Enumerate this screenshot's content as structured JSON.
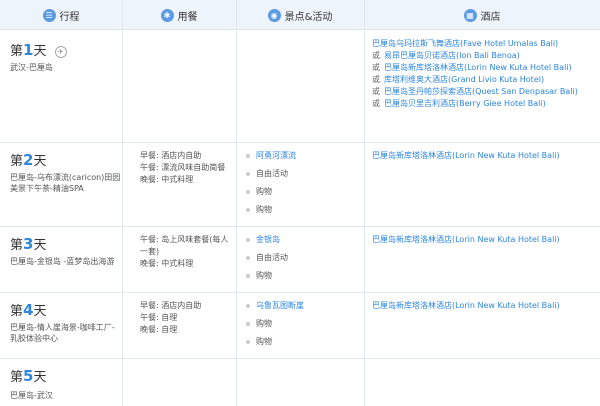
{
  "header": {
    "itinerary": "行程",
    "meals": "用餐",
    "activities": "景点&活动",
    "hotel": "酒店"
  },
  "days": [
    {
      "day_prefix": "第",
      "day_num": "1",
      "day_suffix": "天",
      "route": "武汉-巴厘岛",
      "meals": [],
      "activities": [],
      "hotels": [
        "巴厘岛乌玛拉斯飞舞酒店(Fave Hotel Umalas Bali)",
        "易昂巴厘岛贝诺酒店(Ion Bali Benoa)",
        "巴厘岛新库塔洛林酒店(Lorin New Kuta Hotel Bali)",
        "库塔利维奥大酒店(Grand Livio Kuta Hotel)",
        "巴厘岛圣丹帕莎探索酒店(Quest San Denpasar Bali)",
        "巴厘岛贝里吉利酒店(Berry Giee Hotel Bali)"
      ],
      "or_label": "或"
    },
    {
      "day_prefix": "第",
      "day_num": "2",
      "day_suffix": "天",
      "route": "巴厘岛-乌布漂流(caricon)田园美景下午茶-精油SPA",
      "meals": [
        "早餐: 酒店内自助",
        "午餐: 漂流风味自助简餐",
        "晚餐: 中式料理"
      ],
      "activities": [
        {
          "label": "阿勇河漂流",
          "link": true
        },
        {
          "label": "自由活动",
          "link": false
        },
        {
          "label": "购物",
          "link": false
        },
        {
          "label": "购物",
          "link": false
        }
      ],
      "hotels": [
        "巴厘岛新库塔洛林酒店(Lorin New Kuta Hotel Bali)"
      ]
    },
    {
      "day_prefix": "第",
      "day_num": "3",
      "day_suffix": "天",
      "route": "巴厘岛-金银岛 -蓝梦岛出海游",
      "meals": [
        "午餐: 岛上风味套餐(每人一套)",
        "晚餐: 中式料理"
      ],
      "activities": [
        {
          "label": "金银岛",
          "link": true
        },
        {
          "label": "自由活动",
          "link": false
        },
        {
          "label": "购物",
          "link": false
        }
      ],
      "hotels": [
        "巴厘岛新库塔洛林酒店(Lorin New Kuta Hotel Bali)"
      ]
    },
    {
      "day_prefix": "第",
      "day_num": "4",
      "day_suffix": "天",
      "route": "巴厘岛-情人崖海景-咖啡工厂-乳胶体验中心",
      "meals": [
        "早餐: 酒店内自助",
        "午餐: 自理",
        "晚餐: 自理"
      ],
      "activities": [
        {
          "label": "乌鲁瓦图断崖",
          "link": true
        },
        {
          "label": "购物",
          "link": false
        },
        {
          "label": "购物",
          "link": false
        }
      ],
      "hotels": [
        "巴厘岛新库塔洛林酒店(Lorin New Kuta Hotel Bali)"
      ]
    },
    {
      "day_prefix": "第",
      "day_num": "5",
      "day_suffix": "天",
      "route": "巴厘岛-武汉",
      "meals": [],
      "activities": [],
      "hotels": []
    }
  ]
}
